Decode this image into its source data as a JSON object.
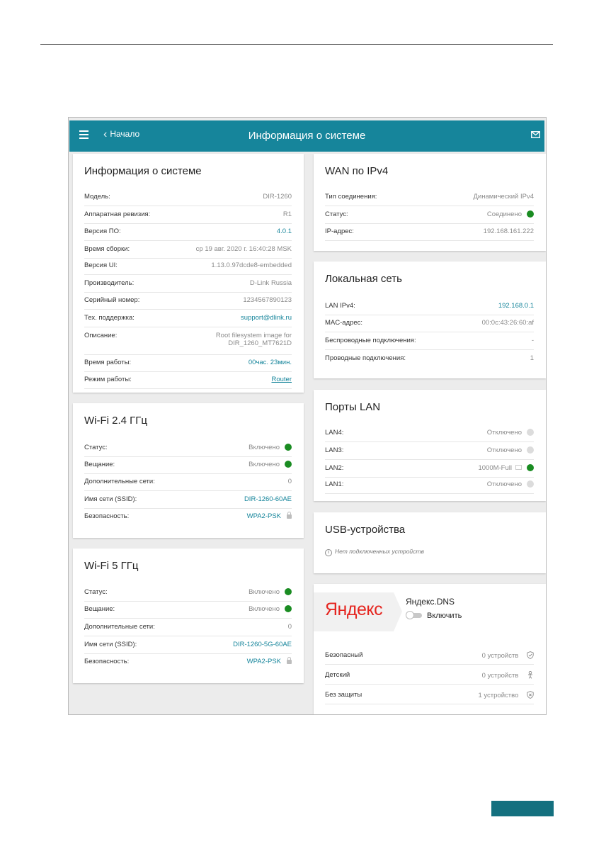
{
  "header": {
    "back_label": "Начало",
    "title": "Информация о системе"
  },
  "sysinfo": {
    "title": "Информация о системе",
    "rows": [
      {
        "label": "Модель:",
        "value": "DIR-1260"
      },
      {
        "label": "Аппаратная ревизия:",
        "value": "R1"
      },
      {
        "label": "Версия ПО:",
        "value": "4.0.1"
      },
      {
        "label": "Время сборки:",
        "value": "ср 19 авг. 2020 г. 16:40:28 MSK"
      },
      {
        "label": "Версия UI:",
        "value": "1.13.0.97dcde8-embedded"
      },
      {
        "label": "Производитель:",
        "value": "D-Link Russia"
      },
      {
        "label": "Серийный номер:",
        "value": "1234567890123"
      },
      {
        "label": "Тех. поддержка:",
        "value": "support@dlink.ru"
      },
      {
        "label": "Описание:",
        "value_line1": "Root filesystem image for",
        "value_line2": "DIR_1260_MT7621D"
      },
      {
        "label": "Время работы:",
        "value": "00час. 23мин."
      },
      {
        "label": "Режим работы:",
        "value": "Router"
      }
    ]
  },
  "wifi24": {
    "title": "Wi-Fi 2.4 ГГц",
    "rows": [
      {
        "label": "Статус:",
        "value": "Включено"
      },
      {
        "label": "Вещание:",
        "value": "Включено"
      },
      {
        "label": "Дополнительные сети:",
        "value": "0"
      },
      {
        "label": "Имя сети (SSID):",
        "value": "DIR-1260-60AE"
      },
      {
        "label": "Безопасность:",
        "value": "WPA2-PSK"
      }
    ]
  },
  "wifi5": {
    "title": "Wi-Fi 5 ГГц",
    "rows": [
      {
        "label": "Статус:",
        "value": "Включено"
      },
      {
        "label": "Вещание:",
        "value": "Включено"
      },
      {
        "label": "Дополнительные сети:",
        "value": "0"
      },
      {
        "label": "Имя сети (SSID):",
        "value": "DIR-1260-5G-60AE"
      },
      {
        "label": "Безопасность:",
        "value": "WPA2-PSK"
      }
    ]
  },
  "wan": {
    "title": "WAN по IPv4",
    "rows": [
      {
        "label": "Тип соединения:",
        "value": "Динамический IPv4"
      },
      {
        "label": "Статус:",
        "value": "Соединено"
      },
      {
        "label": "IP-адрес:",
        "value": "192.168.161.222"
      }
    ]
  },
  "lan": {
    "title": "Локальная сеть",
    "rows": [
      {
        "label": "LAN IPv4:",
        "value": "192.168.0.1"
      },
      {
        "label": "MAC-адрес:",
        "value": "00:0c:43:26:60:af"
      },
      {
        "label": "Беспроводные подключения:",
        "value": "-"
      },
      {
        "label": "Проводные подключения:",
        "value": "1"
      }
    ]
  },
  "ports": {
    "title": "Порты LAN",
    "rows": [
      {
        "label": "LAN4:",
        "value": "Отключено"
      },
      {
        "label": "LAN3:",
        "value": "Отключено"
      },
      {
        "label": "LAN2:",
        "value": "1000M-Full"
      },
      {
        "label": "LAN1:",
        "value": "Отключено"
      }
    ]
  },
  "usb": {
    "title": "USB-устройства",
    "note": "Нет подключенных устройств"
  },
  "yandex": {
    "logo_text": "Яндекс",
    "title": "Яндекс.DNS",
    "toggle_label": "Включить",
    "rows": [
      {
        "label": "Безопасный",
        "value": "0 устройств"
      },
      {
        "label": "Детский",
        "value": "0 устройств"
      },
      {
        "label": "Без защиты",
        "value": "1 устройство"
      }
    ]
  },
  "colors": {
    "header": "#16859b",
    "status_on": "#1a8c22",
    "status_off": "#dcdcdc",
    "yandex_red": "#e52620"
  }
}
